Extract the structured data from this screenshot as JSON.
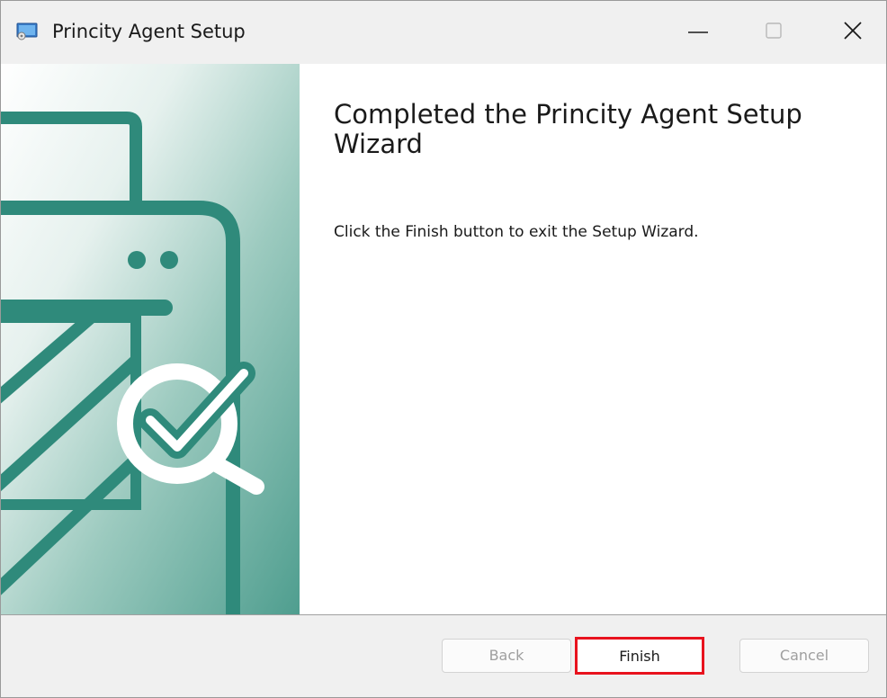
{
  "window": {
    "title": "Princity Agent Setup",
    "controls": {
      "minimize": "minimize-icon",
      "maximize": "maximize-icon",
      "close": "close-icon"
    }
  },
  "main": {
    "heading": "Completed the Princity Agent Setup Wizard",
    "description": "Click the Finish button to exit the Setup Wizard."
  },
  "footer": {
    "back_label": "Back",
    "finish_label": "Finish",
    "cancel_label": "Cancel"
  },
  "banner": {
    "illustration": "printer-check-magnifier-illustration"
  },
  "colors": {
    "banner_teal": "#2f8a7b",
    "banner_light": "#6fb0a2",
    "highlight_red": "#e8131e",
    "disabled_text": "#9f9f9f"
  },
  "state": {
    "back_enabled": false,
    "cancel_enabled": false,
    "finish_highlighted": true
  }
}
